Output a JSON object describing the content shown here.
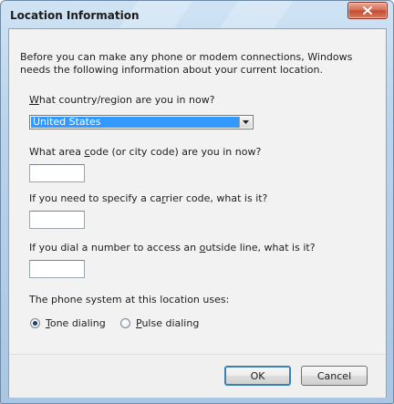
{
  "window": {
    "title": "Location Information",
    "close_symbol": "x"
  },
  "intro_text": "Before you can make any phone or modem connections, Windows needs the following information about your current location.",
  "country": {
    "label_prefix": "",
    "label_mnemonic": "W",
    "label_rest": "hat country/region are you in now?",
    "selected_value": "United States"
  },
  "area_code": {
    "label_before": "What area ",
    "label_mnemonic": "c",
    "label_after": "ode (or city code) are you in now?",
    "value": ""
  },
  "carrier_code": {
    "label_before": "If you need to specify a ca",
    "label_mnemonic": "r",
    "label_after": "rier code, what is it?",
    "value": ""
  },
  "outside_line": {
    "label_before": "If you dial a number to access an ",
    "label_mnemonic": "o",
    "label_after": "utside line, what is it?",
    "value": ""
  },
  "dialing": {
    "label": "The phone system at this location uses:",
    "tone_mnemonic": "T",
    "tone_rest": "one dialing",
    "pulse_mnemonic": "P",
    "pulse_rest": "ulse dialing",
    "selected": "tone"
  },
  "buttons": {
    "ok": "OK",
    "cancel": "Cancel"
  }
}
